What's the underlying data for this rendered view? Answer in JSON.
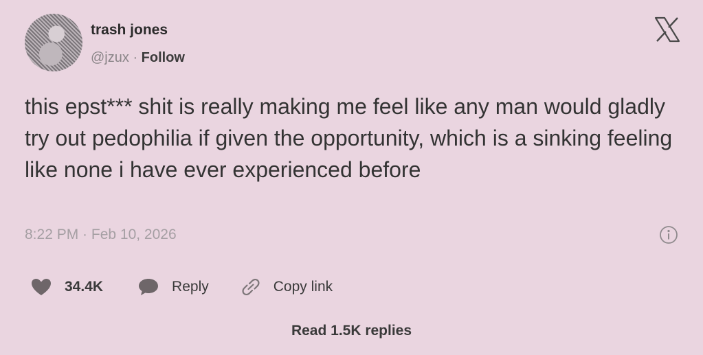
{
  "author": {
    "name": "trash jones",
    "handle": "@jzux",
    "separator": "·",
    "follow_label": "Follow"
  },
  "tweet": {
    "text": "this epst*** shit is really making me feel like any man would gladly try out pedophilia if given the opportunity, which is a sinking feeling like none i have ever experienced before",
    "timestamp": "8:22 PM · Feb 10, 2026"
  },
  "actions": {
    "like_count": "34.4K",
    "reply_label": "Reply",
    "copy_link_label": "Copy link"
  },
  "footer": {
    "read_replies_label": "Read 1.5K replies"
  },
  "icons": {
    "close": "x-logo-icon",
    "info": "info-icon",
    "like": "heart-icon",
    "reply": "speech-bubble-icon",
    "copy_link": "link-icon"
  },
  "colors": {
    "background": "#ead5e0",
    "text": "#333333",
    "muted": "#a59fa3"
  }
}
